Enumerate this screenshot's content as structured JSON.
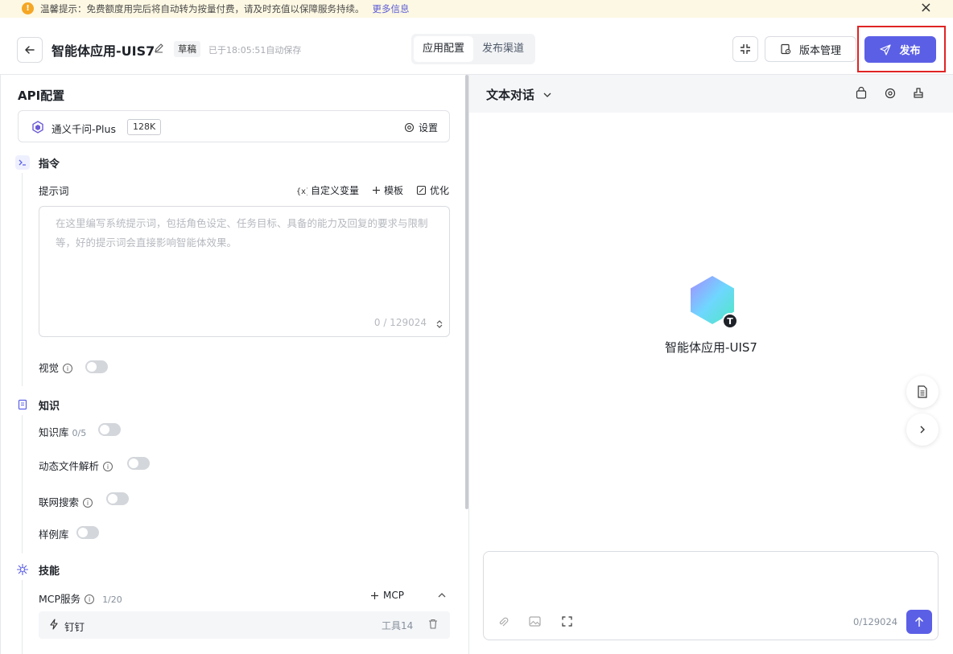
{
  "notice": {
    "icon": "warning-icon",
    "text": "温馨提示：免费额度用完后将自动转为按量付费，请及时充值以保障服务持续。",
    "link": "更多信息"
  },
  "header": {
    "app_title": "智能体应用-UIS7",
    "draft_badge": "草稿",
    "autosave": "已于18:05:51自动保存",
    "tabs": [
      {
        "label": "应用配置",
        "active": true
      },
      {
        "label": "发布渠道",
        "active": false
      }
    ],
    "version_button": "版本管理",
    "publish_button": "发布",
    "accent_color": "#5b5fe6"
  },
  "config": {
    "title": "API配置",
    "model": {
      "name": "通义千问-Plus",
      "context": "128K",
      "settings_label": "设置"
    },
    "instruction": {
      "title": "指令",
      "prompt_label": "提示词",
      "tools": [
        "自定义变量",
        "模板",
        "优化"
      ],
      "placeholder": "在这里编写系统提示词，包括角色设定、任务目标、具备的能力及回复的要求与限制等，好的提示词会直接影响智能体效果。",
      "count": "0 / 129024",
      "vision_label": "视觉"
    },
    "knowledge": {
      "title": "知识",
      "kb_label": "知识库",
      "kb_count": "0/5",
      "dynamic_file_label": "动态文件解析",
      "web_search_label": "联网搜索",
      "sample_lib_label": "样例库"
    },
    "skills": {
      "title": "技能",
      "mcp_label": "MCP服务",
      "mcp_count": "1/20",
      "mcp_add": "MCP",
      "tools": [
        {
          "name": "钉钉",
          "count": "工具14"
        }
      ]
    }
  },
  "preview": {
    "mode": "文本对话",
    "agent_name": "智能体应用-UIS7",
    "avatar_badge": "T",
    "chat_count": "0/129024"
  }
}
